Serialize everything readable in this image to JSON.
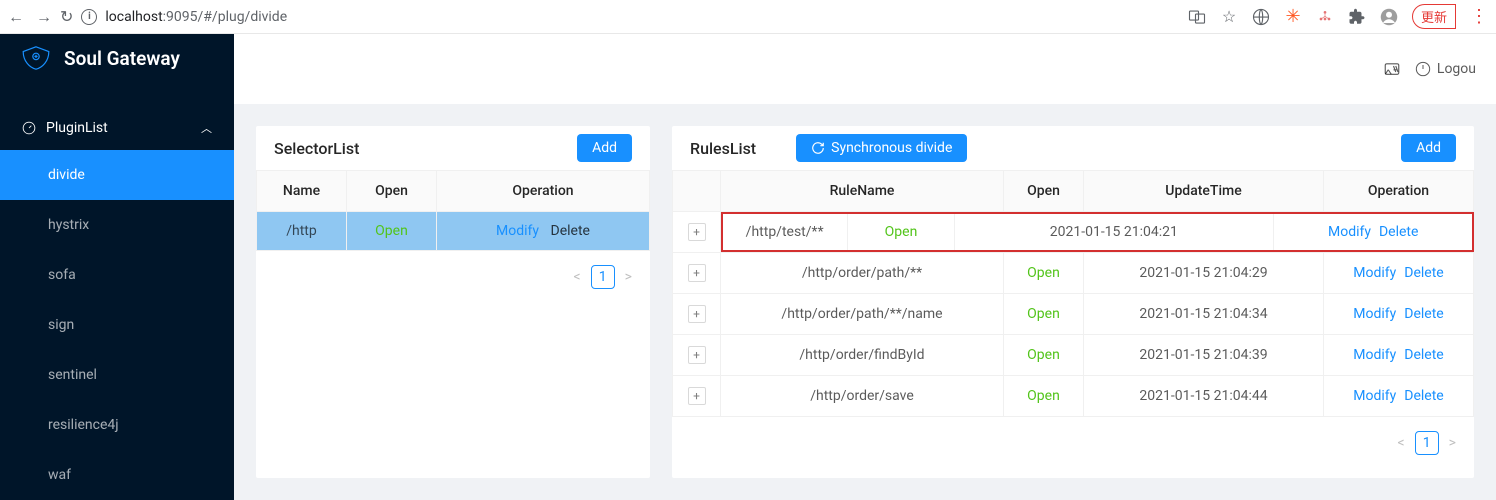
{
  "browser": {
    "url_host": "localhost",
    "url_port": ":9095",
    "url_path": "/#/plug/divide",
    "update_label": "更新"
  },
  "app": {
    "title": "Soul Gateway",
    "logout_label": "Logou"
  },
  "sidebar": {
    "section_title": "PluginList",
    "items": [
      {
        "label": "divide",
        "active": true
      },
      {
        "label": "hystrix",
        "active": false
      },
      {
        "label": "sofa",
        "active": false
      },
      {
        "label": "sign",
        "active": false
      },
      {
        "label": "sentinel",
        "active": false
      },
      {
        "label": "resilience4j",
        "active": false
      },
      {
        "label": "waf",
        "active": false
      }
    ]
  },
  "selector": {
    "title": "SelectorList",
    "add_label": "Add",
    "columns": {
      "name": "Name",
      "open": "Open",
      "operation": "Operation"
    },
    "rows": [
      {
        "name": "/http",
        "open": "Open",
        "modify": "Modify",
        "delete": "Delete"
      }
    ],
    "page": "1"
  },
  "rules": {
    "title": "RulesList",
    "sync_label": "Synchronous divide",
    "add_label": "Add",
    "columns": {
      "name": "RuleName",
      "open": "Open",
      "time": "UpdateTime",
      "operation": "Operation"
    },
    "rows": [
      {
        "name": "/http/test/**",
        "open": "Open",
        "time": "2021-01-15 21:04:21",
        "modify": "Modify",
        "delete": "Delete",
        "highlighted": true
      },
      {
        "name": "/http/order/path/**",
        "open": "Open",
        "time": "2021-01-15 21:04:29",
        "modify": "Modify",
        "delete": "Delete",
        "highlighted": false
      },
      {
        "name": "/http/order/path/**/name",
        "open": "Open",
        "time": "2021-01-15 21:04:34",
        "modify": "Modify",
        "delete": "Delete",
        "highlighted": false
      },
      {
        "name": "/http/order/findById",
        "open": "Open",
        "time": "2021-01-15 21:04:39",
        "modify": "Modify",
        "delete": "Delete",
        "highlighted": false
      },
      {
        "name": "/http/order/save",
        "open": "Open",
        "time": "2021-01-15 21:04:44",
        "modify": "Modify",
        "delete": "Delete",
        "highlighted": false
      }
    ],
    "page": "1"
  }
}
